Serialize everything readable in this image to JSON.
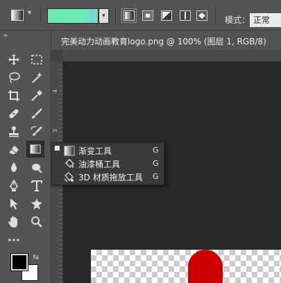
{
  "options_bar": {
    "mode_label": "模式：",
    "mode_value": "正常",
    "gradient_colors": [
      "#6ee6ad",
      "#7ad8c9"
    ]
  },
  "document_tab": {
    "title": "完美动力动画教育logo.png @ 100% (图层 1, RGB/8)"
  },
  "ruler": {
    "left_numbers": [
      "4",
      "3",
      "2"
    ]
  },
  "toolbar": {
    "tools": [
      "move-icon",
      "marquee-icon",
      "lasso-icon",
      "magic-wand-icon",
      "crop-icon",
      "eyedropper-icon",
      "healing-brush-icon",
      "brush-icon",
      "clone-stamp-icon",
      "history-brush-icon",
      "eraser-icon",
      "gradient-icon",
      "blur-icon",
      "dodge-icon",
      "pen-icon",
      "type-icon",
      "path-selection-icon",
      "custom-shape-icon",
      "hand-icon",
      "zoom-icon",
      "more-tools-icon"
    ],
    "foreground_color": "#000000",
    "background_color": "#ffffff"
  },
  "flyout": {
    "items": [
      {
        "label": "渐变工具",
        "shortcut": "G",
        "selected": true
      },
      {
        "label": "油漆桶工具",
        "shortcut": "G",
        "selected": false
      },
      {
        "label": "3D 材质拖放工具",
        "shortcut": "G",
        "selected": false
      }
    ]
  },
  "canvas": {
    "background": "#282828",
    "shape_color": "#cc0000"
  }
}
